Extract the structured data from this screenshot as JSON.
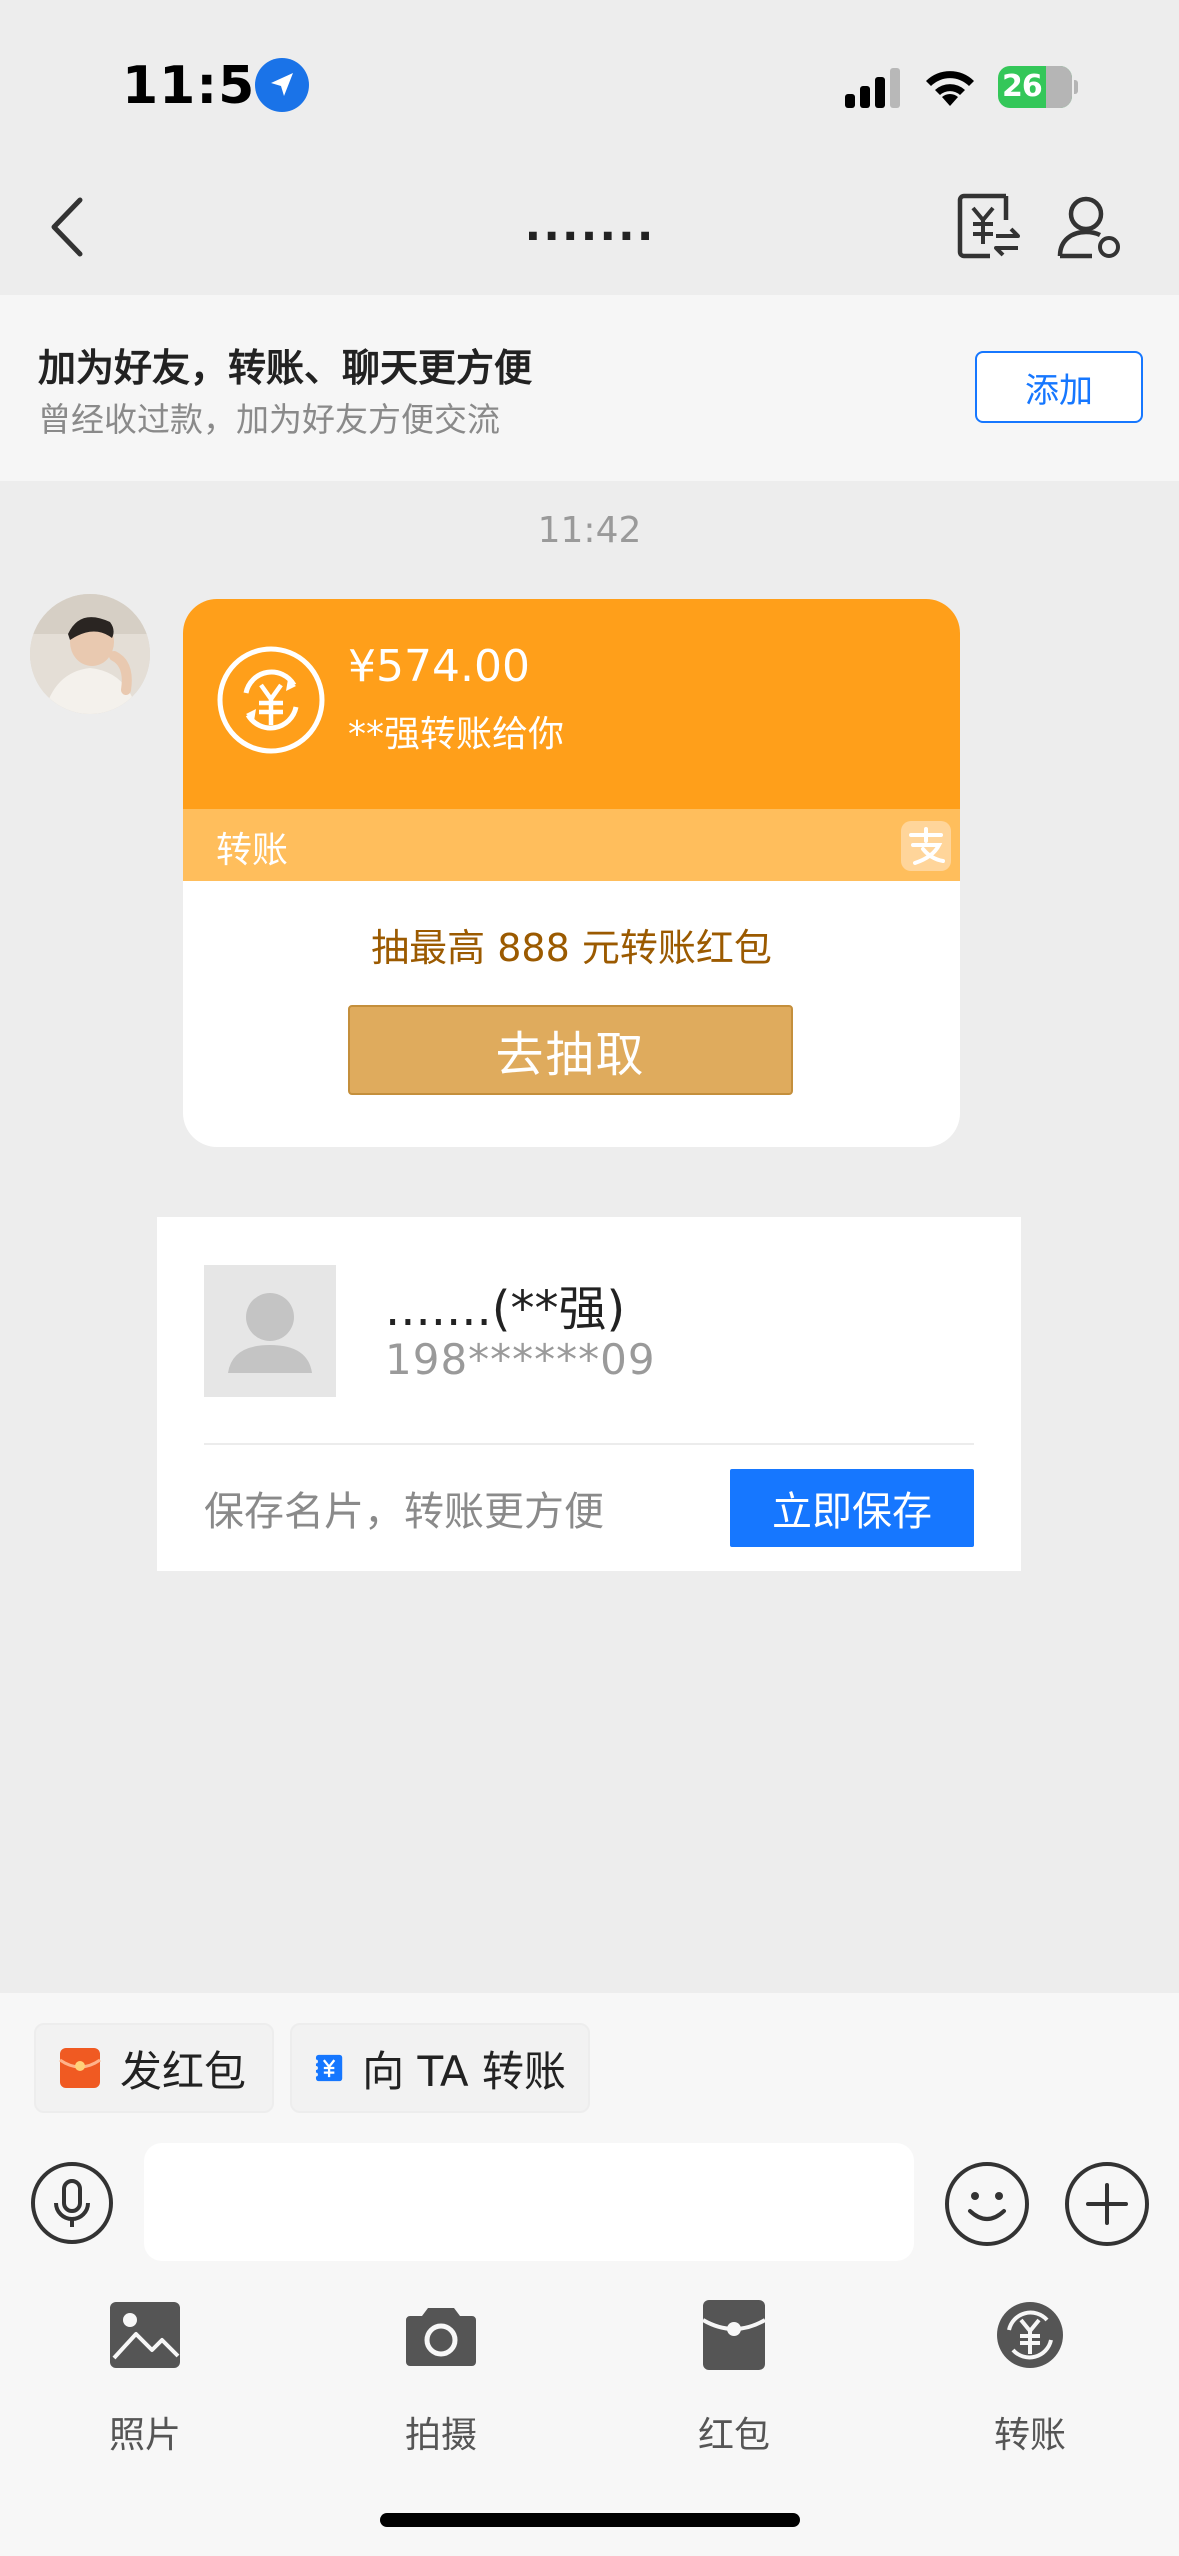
{
  "status_bar": {
    "time": "11:54",
    "battery": "26",
    "icons": [
      "location-arrow-icon",
      "cellular-signal-icon",
      "wifi-icon",
      "battery-charging-icon"
    ]
  },
  "nav": {
    "title": ".......",
    "icons": [
      "back-chevron-icon",
      "transfer-record-icon",
      "profile-settings-icon"
    ]
  },
  "friend_banner": {
    "title": "加为好友，转账、聊天更方便",
    "subtitle": "曾经收过款，加为好友方便交流",
    "add_label": "添加"
  },
  "chat": {
    "timestamp": "11:42",
    "transfer_card": {
      "amount": "¥574.00",
      "desc": "**强转账给你",
      "type_label": "转账",
      "promo": "抽最高 888 元转账红包",
      "draw_label": "去抽取",
      "accent": "#ff9f1a"
    },
    "contact_card": {
      "name": ".......(**强)",
      "phone": "198******09",
      "tip": "保存名片，转账更方便",
      "save_label": "立即保存"
    }
  },
  "bottom": {
    "chips": [
      {
        "label": "发红包",
        "icon": "red-packet-icon"
      },
      {
        "label": "向 TA 转账",
        "icon": "yuan-transfer-icon"
      }
    ],
    "input_placeholder": "",
    "tools": [
      {
        "label": "照片",
        "icon": "photo-icon"
      },
      {
        "label": "拍摄",
        "icon": "camera-icon"
      },
      {
        "label": "红包",
        "icon": "red-packet-icon"
      },
      {
        "label": "转账",
        "icon": "transfer-icon"
      }
    ]
  },
  "colors": {
    "primary_blue": "#1677ff",
    "orange": "#ff9f1a",
    "gold_button": "#dfab5d"
  }
}
